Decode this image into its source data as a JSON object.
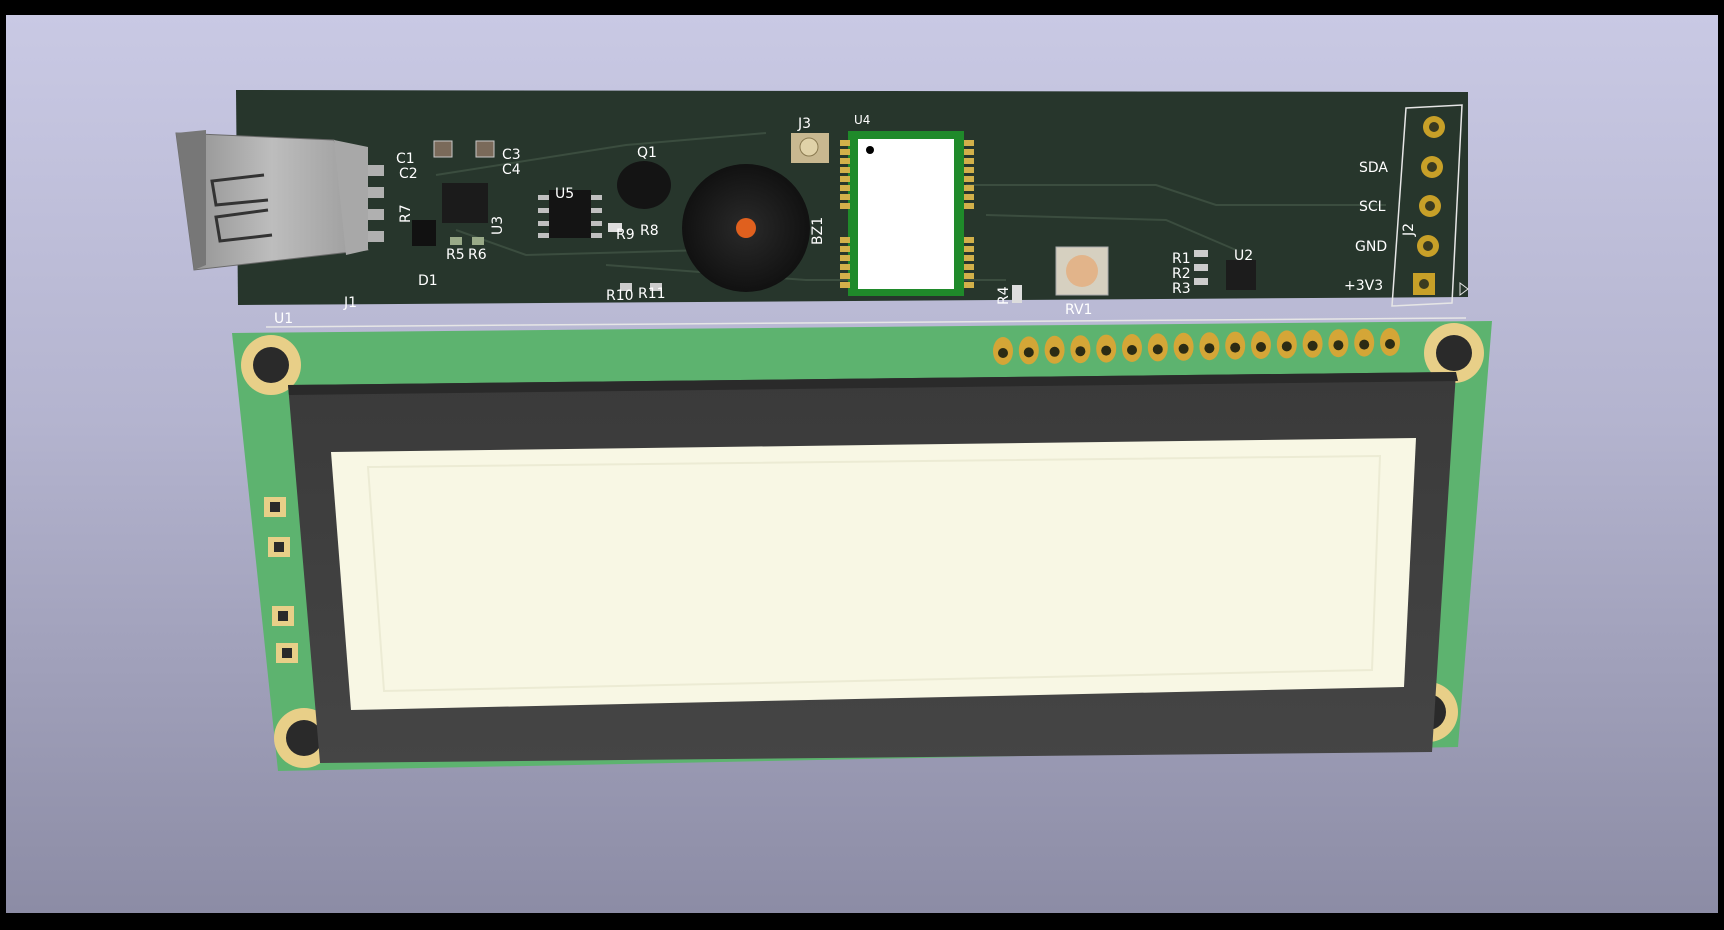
{
  "viewer": {
    "background_top": "#c9c9e4",
    "background_bottom": "#8c8ca5",
    "board_color": "#27362c",
    "lcd_pcb_color": "#5db36f",
    "pad_color": "#c8a028"
  },
  "references": {
    "c1": "C1",
    "c2": "C2",
    "c3": "C3",
    "c4": "C4",
    "q1": "Q1",
    "j3": "J3",
    "u4": "U4",
    "u5": "U5",
    "r7": "R7",
    "u3": "U3",
    "r5": "R5",
    "r6": "R6",
    "d1": "D1",
    "j1": "J1",
    "r9": "R9",
    "r8": "R8",
    "r10": "R10",
    "r11": "R11",
    "bz1": "BZ1",
    "r4": "R4",
    "rv1": "RV1",
    "r1": "R1",
    "r2": "R2",
    "r3": "R3",
    "u2": "U2",
    "j2": "J2",
    "u1": "U1"
  },
  "connector_j2": {
    "pins": [
      "SDA",
      "SCL",
      "GND",
      "+3V3"
    ]
  }
}
